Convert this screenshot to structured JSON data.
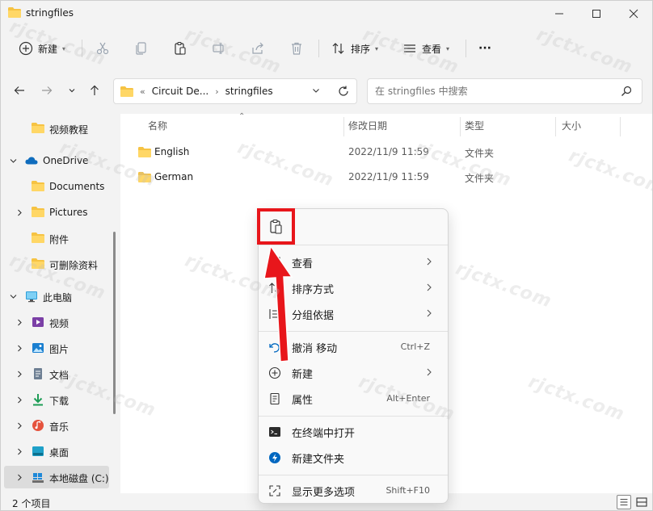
{
  "window": {
    "title": "stringfiles"
  },
  "toolbar": {
    "new_label": "新建",
    "sort_label": "排序",
    "view_label": "查看",
    "more_label": "···"
  },
  "address": {
    "crumb_collapse": "«",
    "crumb_1": "Circuit De...",
    "crumb_2": "stringfiles"
  },
  "search": {
    "placeholder": "在 stringfiles 中搜索"
  },
  "navpane": {
    "items": [
      {
        "label": "视频教程"
      },
      {
        "label": "OneDrive"
      },
      {
        "label": "Documents"
      },
      {
        "label": "Pictures"
      },
      {
        "label": "附件"
      },
      {
        "label": "可删除资料"
      },
      {
        "label": "此电脑"
      },
      {
        "label": "视频"
      },
      {
        "label": "图片"
      },
      {
        "label": "文档"
      },
      {
        "label": "下载"
      },
      {
        "label": "音乐"
      },
      {
        "label": "桌面"
      },
      {
        "label": "本地磁盘 (C:)"
      }
    ]
  },
  "columns": {
    "name": "名称",
    "date": "修改日期",
    "type": "类型",
    "size": "大小"
  },
  "files": [
    {
      "name": "English",
      "date": "2022/11/9 11:59",
      "type": "文件夹"
    },
    {
      "name": "German",
      "date": "2022/11/9 11:59",
      "type": "文件夹"
    }
  ],
  "status": {
    "count": "2 个项目"
  },
  "context_menu": {
    "items": [
      {
        "label": "查看",
        "shortcut": ""
      },
      {
        "label": "排序方式",
        "shortcut": ""
      },
      {
        "label": "分组依据",
        "shortcut": ""
      },
      {
        "label": "撤消 移动",
        "shortcut": "Ctrl+Z"
      },
      {
        "label": "新建",
        "shortcut": ""
      },
      {
        "label": "属性",
        "shortcut": "Alt+Enter"
      },
      {
        "label": "在终端中打开",
        "shortcut": ""
      },
      {
        "label": "新建文件夹",
        "shortcut": ""
      },
      {
        "label": "显示更多选项",
        "shortcut": "Shift+F10"
      }
    ]
  },
  "watermark": "rjctx.com",
  "colors": {
    "highlight": "#e8161b",
    "folder": "#f6c343",
    "accent": "#0067c0"
  }
}
